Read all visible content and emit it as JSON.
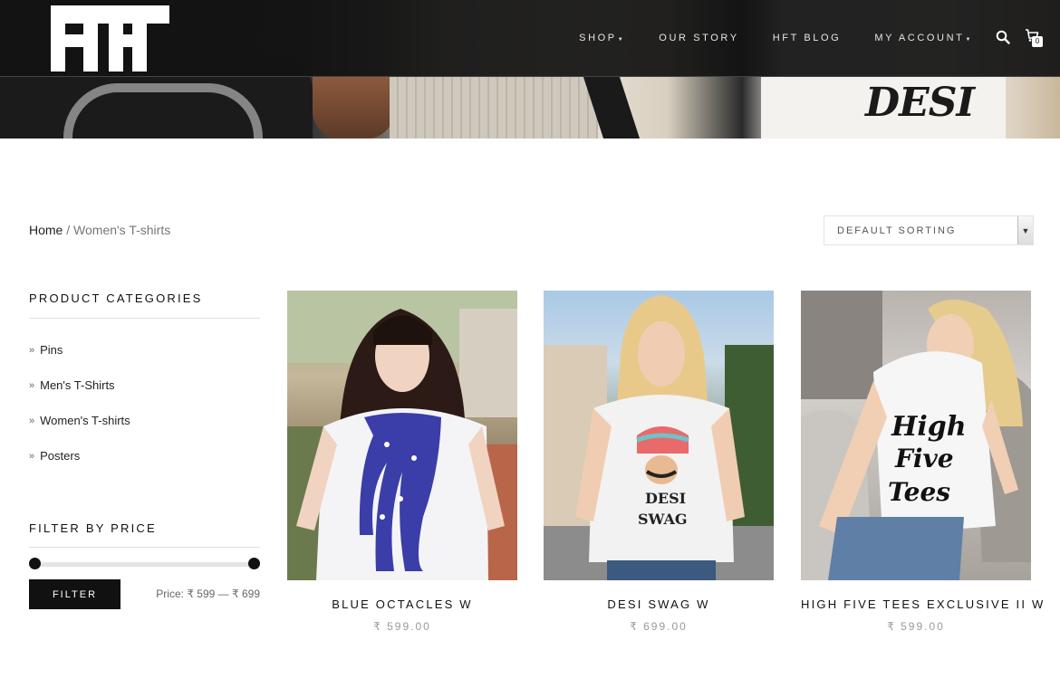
{
  "header": {
    "logo_text": "HFT",
    "nav": [
      {
        "label": "SHOP",
        "has_dropdown": true
      },
      {
        "label": "OUR STORY",
        "has_dropdown": false
      },
      {
        "label": "HFT BLOG",
        "has_dropdown": false
      },
      {
        "label": "MY ACCOUNT",
        "has_dropdown": true
      }
    ],
    "cart_count": "0",
    "icons": [
      "search-icon",
      "cart-icon"
    ]
  },
  "hero": {
    "print_text": "DESI"
  },
  "breadcrumb": {
    "home": "Home",
    "separator": " / ",
    "current": "Women's T-shirts"
  },
  "sorting": {
    "selected": "DEFAULT SORTING"
  },
  "sidebar": {
    "categories_title": "PRODUCT CATEGORIES",
    "categories": [
      {
        "label": "Pins"
      },
      {
        "label": "Men's T-Shirts"
      },
      {
        "label": "Women's T-shirts"
      },
      {
        "label": "Posters"
      }
    ],
    "filter_title": "FILTER BY PRICE",
    "filter_button": "FILTER",
    "price_label": "Price:",
    "price_min": "₹ 599",
    "price_dash": "—",
    "price_max": "₹ 699",
    "slider_min_fraction": 0,
    "slider_max_fraction": 1
  },
  "products": [
    {
      "name": "BLUE OCTACLES W",
      "price": "₹ 599.00",
      "image": "woman-octopus-tee"
    },
    {
      "name": "DESI SWAG W",
      "price": "₹ 699.00",
      "image": "woman-desi-swag-tee"
    },
    {
      "name": "HIGH FIVE TEES EXCLUSIVE II W",
      "price": "₹ 599.00",
      "image": "woman-high-five-tee"
    }
  ],
  "colors": {
    "header_bg": "#121212",
    "button_bg": "#111111",
    "text": "#222222",
    "muted": "#999999",
    "octopus_blue": "#3b3da8"
  }
}
